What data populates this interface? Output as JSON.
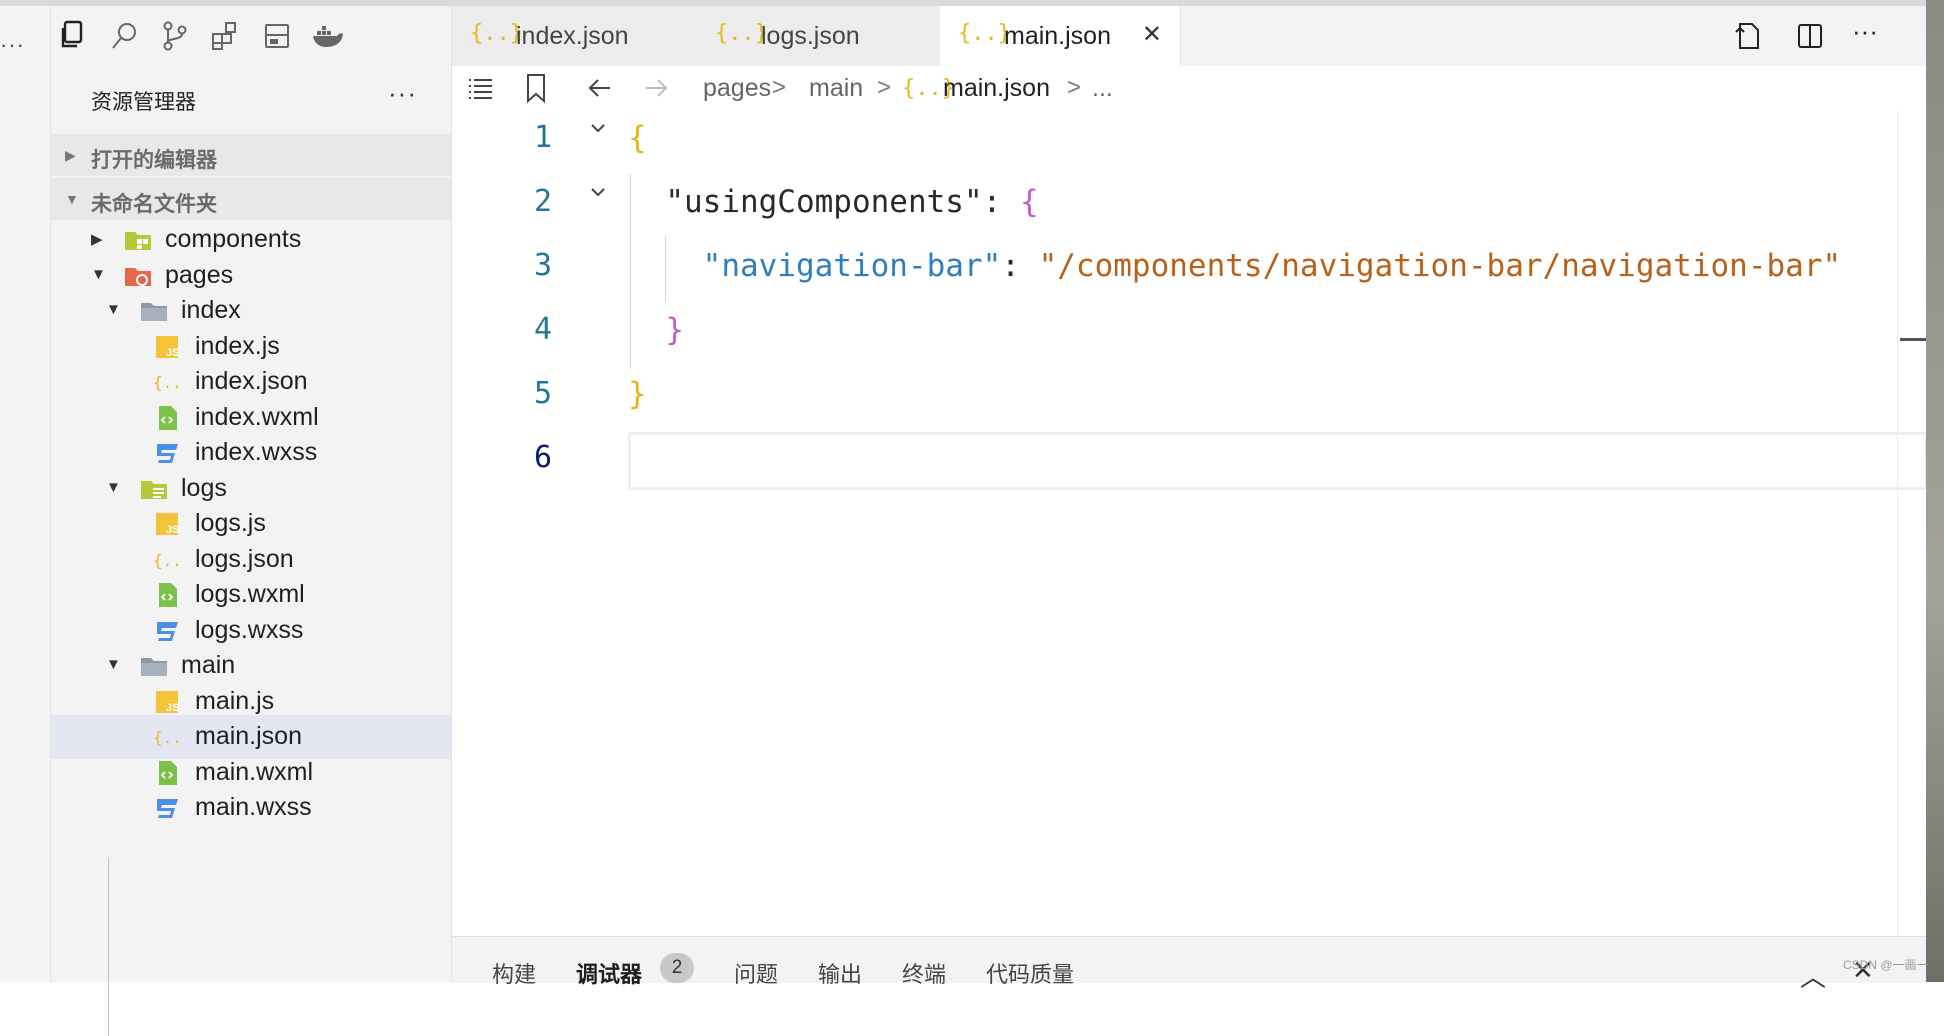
{
  "left_strip": {
    "more": "···"
  },
  "activity": {
    "icons": [
      "explorer-icon",
      "search-icon",
      "source-control-icon",
      "extensions-icon",
      "layout-icon",
      "docker-icon"
    ]
  },
  "explorer": {
    "title": "资源管理器",
    "more": "···",
    "sections": [
      {
        "label": "打开的编辑器",
        "expanded": false
      },
      {
        "label": "未命名文件夹",
        "expanded": true
      }
    ],
    "tree": [
      {
        "name": "components",
        "type": "folder",
        "expanded": false,
        "depth": 0
      },
      {
        "name": "pages",
        "type": "folder",
        "expanded": true,
        "depth": 0
      },
      {
        "name": "index",
        "type": "folder",
        "expanded": true,
        "depth": 1
      },
      {
        "name": "index.js",
        "type": "js",
        "depth": 2
      },
      {
        "name": "index.json",
        "type": "json",
        "depth": 2
      },
      {
        "name": "index.wxml",
        "type": "wxml",
        "depth": 2
      },
      {
        "name": "index.wxss",
        "type": "wxss",
        "depth": 2
      },
      {
        "name": "logs",
        "type": "folder",
        "expanded": true,
        "depth": 1
      },
      {
        "name": "logs.js",
        "type": "js",
        "depth": 2
      },
      {
        "name": "logs.json",
        "type": "json",
        "depth": 2
      },
      {
        "name": "logs.wxml",
        "type": "wxml",
        "depth": 2
      },
      {
        "name": "logs.wxss",
        "type": "wxss",
        "depth": 2
      },
      {
        "name": "main",
        "type": "folder",
        "expanded": true,
        "depth": 1
      },
      {
        "name": "main.js",
        "type": "js",
        "depth": 2
      },
      {
        "name": "main.json",
        "type": "json",
        "depth": 2,
        "selected": true
      },
      {
        "name": "main.wxml",
        "type": "wxml",
        "depth": 2
      },
      {
        "name": "main.wxss",
        "type": "wxss",
        "depth": 2
      }
    ]
  },
  "tabs": [
    {
      "label": "index.json",
      "icon": "json-icon",
      "active": false
    },
    {
      "label": "logs.json",
      "icon": "json-icon",
      "active": false
    },
    {
      "label": "main.json",
      "icon": "json-icon",
      "active": true,
      "close": "✕"
    }
  ],
  "json_icon_text": "{..}",
  "toolbar_right_icons": [
    "open-changes-icon",
    "split-editor-icon",
    "more-actions-icon"
  ],
  "toolbar_more": "···",
  "breadcrumb": [
    "pages",
    "main",
    "main.json",
    "..."
  ],
  "breadcrumb_sep": ">",
  "code": {
    "line_numbers": [
      "1",
      "2",
      "3",
      "4",
      "5",
      "6"
    ],
    "line1_open": "{",
    "line2_key": "\"usingComponents\"",
    "line2_colon": ": ",
    "line2_open": "{",
    "line3_key": "\"navigation-bar\"",
    "line3_colon": ": ",
    "line3_value": "\"/components/navigation-bar/navigation-bar\"",
    "line4_close": "}",
    "line5_close": "}"
  },
  "panel": {
    "tabs": [
      "构建",
      "调试器",
      "问题",
      "输出",
      "终端",
      "代码质量"
    ],
    "active": "调试器",
    "debugger_badge": "2",
    "up": "︿",
    "close": "✕"
  },
  "watermark": "CSDN @一画一"
}
